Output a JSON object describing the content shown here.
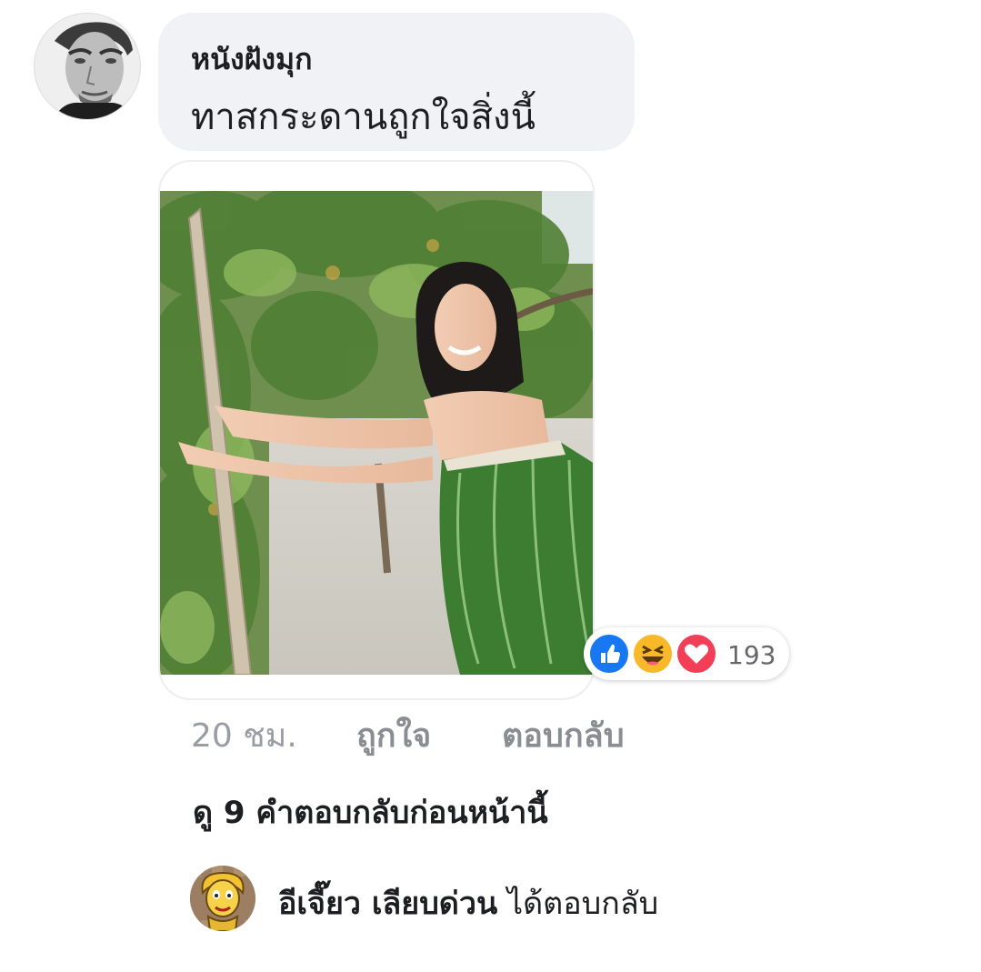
{
  "comment": {
    "author": "หนังฝังมุก",
    "text": "ทาสกระดานถูกใจสิ่งนี้"
  },
  "reactions": {
    "icons": [
      "like-icon",
      "haha-icon",
      "love-icon"
    ],
    "colors": {
      "like": "#1877f2",
      "haha": "#f7b928",
      "love": "#f33e58"
    },
    "count": "193"
  },
  "actions": {
    "time": "20 ชม.",
    "like": "ถูกใจ",
    "reply": "ตอบกลับ"
  },
  "view_previous_replies": "ดู 9 คำตอบกลับก่อนหน้านี้",
  "reply_preview": {
    "name": "อีเจี๊ยว เลียบด่วน",
    "action": "ได้ตอบกลับ"
  }
}
